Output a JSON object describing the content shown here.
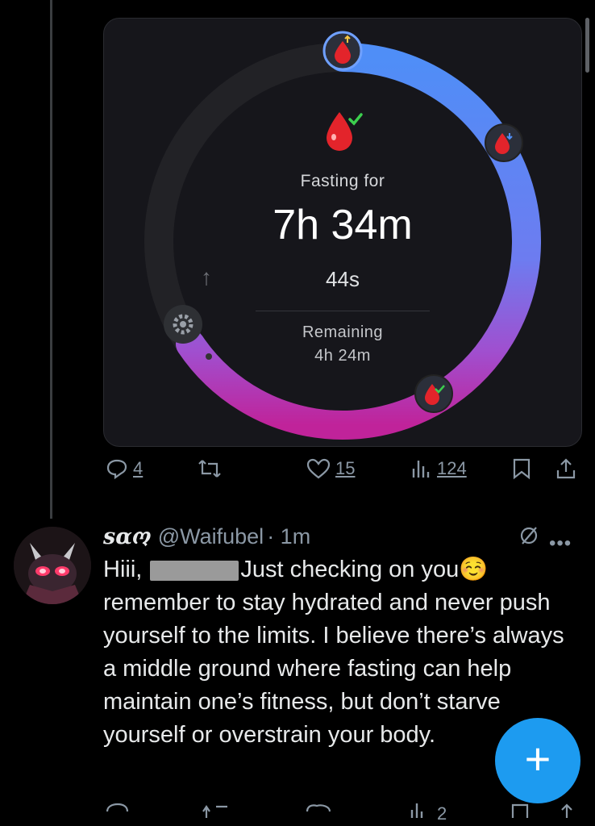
{
  "fasting_card": {
    "status_label": "Fasting for",
    "elapsed": "7h 34m",
    "seconds": "44s",
    "remaining_label": "Remaining",
    "remaining_value": "4h 24m",
    "colors": {
      "ring_blue": "#4f8ef7",
      "ring_magenta": "#c0239a",
      "drop_red": "#e3242b",
      "check_green": "#3ccf4e"
    }
  },
  "tweet_actions": {
    "reply_count": "4",
    "like_count": "15",
    "views_count": "124"
  },
  "reply": {
    "display_name": "sαო",
    "handle": "@Waifubel",
    "time": "· 1m",
    "text_before": "Hiii, ",
    "text_after": "Just checking on you☺️ remember to stay hydrated and never push yourself to the limits. I believe there’s always a middle ground where fasting can help maintain one’s fitness, but don’t starve yourself or overstrain your body."
  },
  "reply_actions": {
    "views_count": "2"
  },
  "compose_button": {
    "label": "+"
  }
}
